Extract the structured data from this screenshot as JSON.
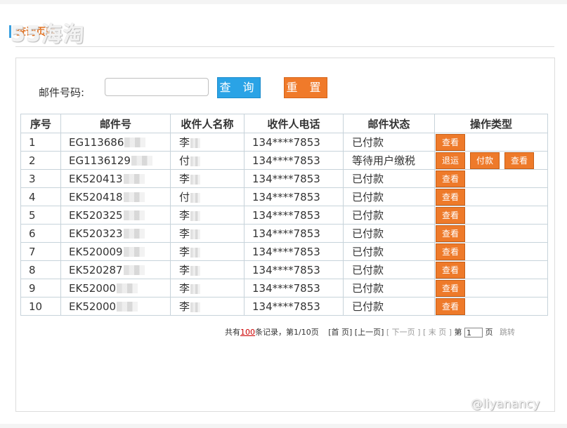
{
  "header": {
    "title": "查询页面",
    "watermark": "55海淘"
  },
  "search": {
    "label": "邮件号码:",
    "value": "",
    "placeholder": "",
    "query_button": "查 询",
    "reset_button": "重 置"
  },
  "table": {
    "headers": [
      "序号",
      "邮件号",
      "收件人名称",
      "收件人电话",
      "邮件状态",
      "操作类型"
    ],
    "rows": [
      {
        "no": "1",
        "mail": "EG113686",
        "name": "李",
        "phone": "134****7853",
        "status": "已付款",
        "ops": [
          "查看"
        ]
      },
      {
        "no": "2",
        "mail": "EG1136129",
        "name": "付",
        "phone": "134****7853",
        "status": "等待用户缴税",
        "ops": [
          "退运",
          "付款",
          "查看"
        ]
      },
      {
        "no": "3",
        "mail": "EK520413",
        "name": "李",
        "phone": "134****7853",
        "status": "已付款",
        "ops": [
          "查看"
        ]
      },
      {
        "no": "4",
        "mail": "EK520418",
        "name": "付",
        "phone": "134****7853",
        "status": "已付款",
        "ops": [
          "查看"
        ]
      },
      {
        "no": "5",
        "mail": "EK520325",
        "name": "李",
        "phone": "134****7853",
        "status": "已付款",
        "ops": [
          "查看"
        ]
      },
      {
        "no": "6",
        "mail": "EK520323",
        "name": "李",
        "phone": "134****7853",
        "status": "已付款",
        "ops": [
          "查看"
        ]
      },
      {
        "no": "7",
        "mail": "EK520009",
        "name": "李",
        "phone": "134****7853",
        "status": "已付款",
        "ops": [
          "查看"
        ]
      },
      {
        "no": "8",
        "mail": "EK520287",
        "name": "李",
        "phone": "134****7853",
        "status": "已付款",
        "ops": [
          "查看"
        ]
      },
      {
        "no": "9",
        "mail": "EK52000",
        "name": "李",
        "phone": "134****7853",
        "status": "已付款",
        "ops": [
          "查看"
        ]
      },
      {
        "no": "10",
        "mail": "EK52000",
        "name": "李",
        "phone": "134****7853",
        "status": "已付款",
        "ops": [
          "查看"
        ]
      }
    ]
  },
  "pager": {
    "total_prefix": "共有",
    "total_count": "100",
    "total_suffix": "条记录，第1/10页",
    "first": "[首 页]",
    "prev": "[上一页]",
    "next": "[ 下一页 ]",
    "last": "[ 末 页 ]",
    "goto_prefix": "第",
    "goto_value": "1",
    "goto_suffix": "页",
    "go": "跳转"
  },
  "credit": "@liyanancy",
  "colors": {
    "accent_blue": "#2aa3e6",
    "accent_orange": "#f07a2a",
    "total_red": "#cc0000"
  }
}
